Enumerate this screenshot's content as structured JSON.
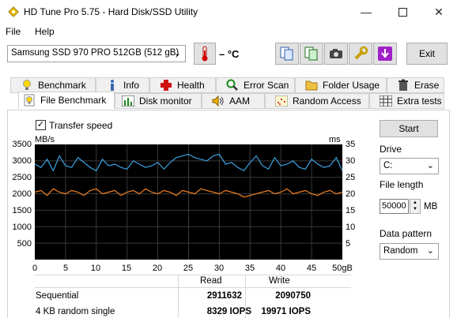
{
  "window": {
    "title": "HD Tune Pro 5.75 - Hard Disk/SSD Utility"
  },
  "menu": {
    "items": [
      {
        "label": "File"
      },
      {
        "label": "Help"
      }
    ]
  },
  "toolbar": {
    "drive": "Samsung SSD 970 PRO 512GB (512 gB)",
    "temperature": "– °C",
    "exit_label": "Exit"
  },
  "tabs": {
    "row1": [
      {
        "label": "Benchmark",
        "icon": "lightbulb-icon"
      },
      {
        "label": "Info",
        "icon": "info-icon"
      },
      {
        "label": "Health",
        "icon": "health-cross-icon"
      },
      {
        "label": "Error Scan",
        "icon": "magnifier-icon"
      },
      {
        "label": "Folder Usage",
        "icon": "folder-icon"
      },
      {
        "label": "Erase",
        "icon": "trash-icon"
      }
    ],
    "row2": [
      {
        "label": "File Benchmark",
        "icon": "file-lightbulb-icon",
        "active": true
      },
      {
        "label": "Disk monitor",
        "icon": "bar-chart-icon"
      },
      {
        "label": "AAM",
        "icon": "speaker-icon"
      },
      {
        "label": "Random Access",
        "icon": "scatter-grid-icon"
      },
      {
        "label": "Extra tests",
        "icon": "grid-icon"
      }
    ]
  },
  "file_benchmark": {
    "transfer_speed_label": "Transfer speed",
    "transfer_speed_checked": true,
    "start_label": "Start",
    "drive_label": "Drive",
    "drive_value": "C:",
    "file_length_label": "File length",
    "file_length_value": "50000",
    "file_length_unit": "MB",
    "data_pattern_label": "Data pattern",
    "data_pattern_value": "Random"
  },
  "results": {
    "headers": {
      "read": "Read",
      "write": "Write"
    },
    "rows": [
      {
        "label": "Sequential",
        "read": "2911632",
        "write": "2090750"
      },
      {
        "label": "4 KB random single",
        "read": "8329 IOPS",
        "write": "19971 IOPS"
      }
    ]
  },
  "chart_data": {
    "type": "line",
    "y_left_label": "MB/s",
    "y_right_label": "ms",
    "y_left_ticks": [
      "3500",
      "3000",
      "2500",
      "2000",
      "1500",
      "1000",
      "500"
    ],
    "y_right_ticks": [
      "35",
      "30",
      "25",
      "20",
      "15",
      "10",
      "5"
    ],
    "x_ticks": [
      "0",
      "5",
      "10",
      "15",
      "20",
      "25",
      "30",
      "35",
      "40",
      "45",
      "50gB"
    ],
    "ylim": [
      0,
      3500
    ],
    "xlim": [
      0,
      50
    ],
    "grid": true,
    "series": [
      {
        "color": "#3aa0e0",
        "x": [
          0,
          1,
          2,
          3,
          4,
          5,
          6,
          7,
          8,
          9,
          10,
          11,
          12,
          13,
          14,
          15,
          16,
          17,
          18,
          19,
          20,
          21,
          22,
          23,
          24,
          25,
          26,
          27,
          28,
          29,
          30,
          31,
          32,
          33,
          34,
          35,
          36,
          37,
          38,
          39,
          40,
          41,
          42,
          43,
          44,
          45,
          46,
          47,
          48,
          49,
          50
        ],
        "values": [
          2900,
          2800,
          3050,
          2700,
          3150,
          2850,
          2800,
          3100,
          2950,
          2800,
          2700,
          3050,
          2850,
          2900,
          2800,
          2750,
          3000,
          2900,
          2800,
          2850,
          2950,
          2750,
          2950,
          3100,
          3150,
          3200,
          3100,
          3050,
          3000,
          3150,
          3200,
          2900,
          2950,
          2800,
          2700,
          2950,
          3150,
          2850,
          2750,
          3100,
          2850,
          2900,
          3000,
          2800,
          2750,
          3050,
          2900,
          2800,
          2850,
          3100,
          2700
        ]
      },
      {
        "color": "#f08020",
        "x": [
          0,
          1,
          2,
          3,
          4,
          5,
          6,
          7,
          8,
          9,
          10,
          11,
          12,
          13,
          14,
          15,
          16,
          17,
          18,
          19,
          20,
          21,
          22,
          23,
          24,
          25,
          26,
          27,
          28,
          29,
          30,
          31,
          32,
          33,
          34,
          35,
          36,
          37,
          38,
          39,
          40,
          41,
          42,
          43,
          44,
          45,
          46,
          47,
          48,
          49,
          50
        ],
        "values": [
          2050,
          2100,
          1950,
          2150,
          2050,
          2000,
          2100,
          2050,
          1950,
          2100,
          2150,
          2000,
          2050,
          2100,
          1950,
          2050,
          2100,
          2000,
          2150,
          2050,
          2000,
          2100,
          2050,
          1950,
          2100,
          2050,
          2000,
          2150,
          2100,
          2050,
          2000,
          2100,
          2050,
          2000,
          1900,
          1950,
          2000,
          2050,
          2100,
          2000,
          2050,
          2150,
          2000,
          2050,
          2100,
          2000,
          1950,
          2050,
          2100,
          2000,
          2050
        ]
      }
    ]
  }
}
